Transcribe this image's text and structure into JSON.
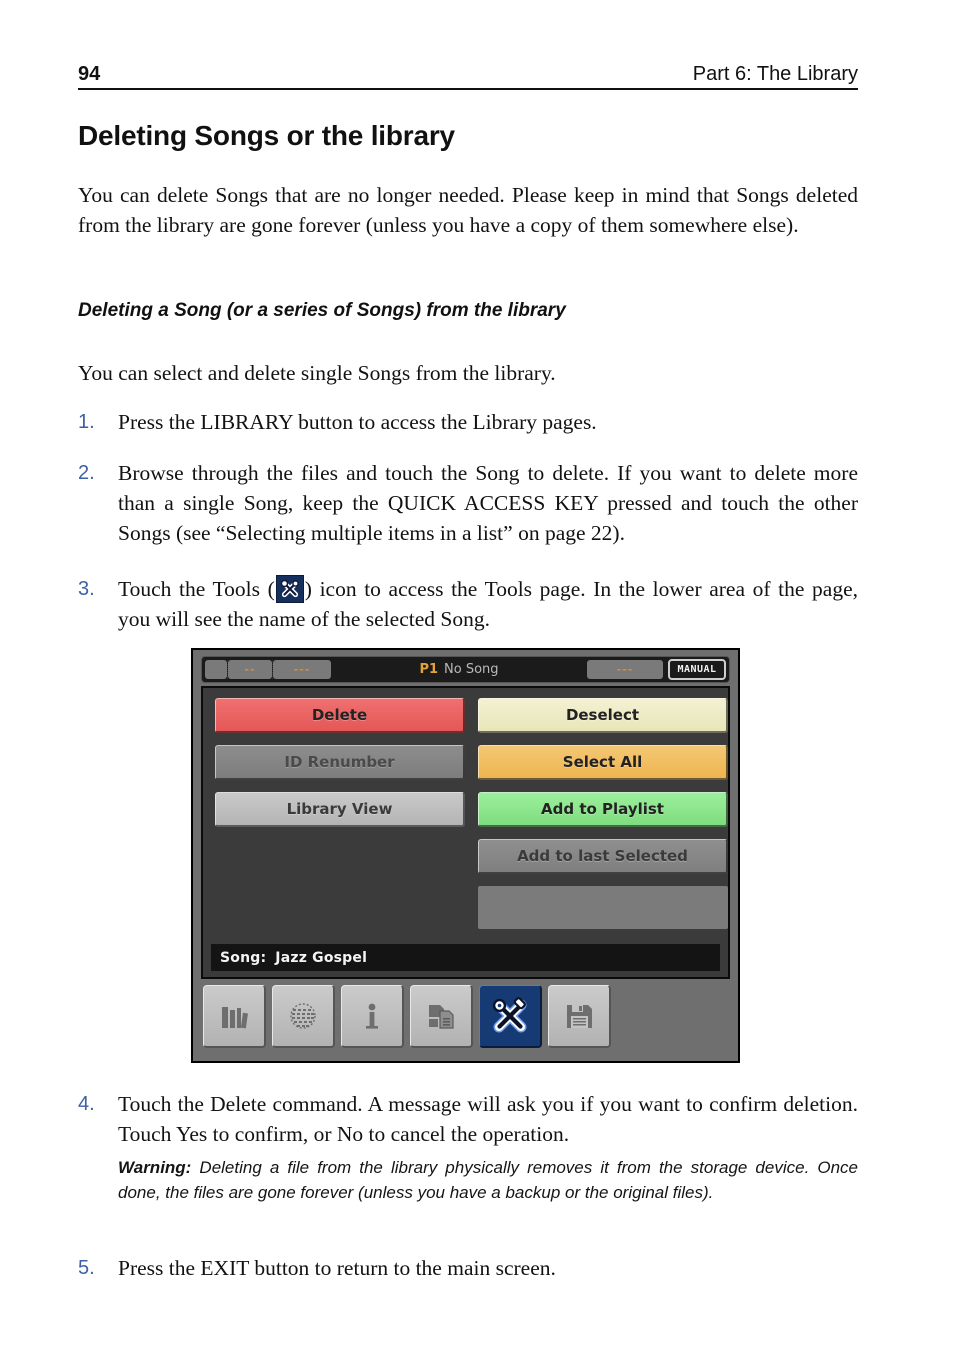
{
  "running_head": {
    "page_number": "94",
    "section": "Part 6: The Library"
  },
  "headings": {
    "h1": "Deleting Songs or the library",
    "h2": "Deleting a Song (or a series of Songs) from the library"
  },
  "paragraphs": {
    "intro": "You can delete Songs that are no longer needed. Please keep in mind that Songs deleted from the library are gone forever (unless you have a copy of them somewhere else).",
    "lead": "You can select and delete single Songs from the library."
  },
  "steps": [
    {
      "number": "1.",
      "text": "Press the LIBRARY button to access the Library pages."
    },
    {
      "number": "2.",
      "text": "Browse through the files and touch the Song to delete. If you want to delete more than a single Song, keep the QUICK ACCESS KEY pressed and touch the other Songs (see “Selecting multiple items in a list” on page 22)."
    },
    {
      "number": "3.",
      "text_before": "Touch the Tools (",
      "text_after": ") icon to access the Tools page. In the lower area of the page, you will see the name of the selected Song."
    },
    {
      "number": "4.",
      "text": "Touch the Delete command. A message will ask you if you want to confirm deletion. Touch Yes to confirm, or No to cancel the operation."
    },
    {
      "number": "5.",
      "text": "Press the EXIT button to return to the main screen."
    }
  ],
  "warning": {
    "label": "Warning:",
    "text": " Deleting a file from the library physically removes it from the storage device. Once done, the files are gone forever (unless you have a backup or the original files)."
  },
  "device": {
    "titlebar": {
      "seg1": "",
      "seg2": "--",
      "seg3": "---",
      "performance": "P1",
      "song_state": "No Song",
      "seg4": "---",
      "mode_button": "MANUAL"
    },
    "buttons_left": [
      {
        "label": "Delete",
        "style": "red"
      },
      {
        "label": "ID Renumber",
        "style": "graydark"
      },
      {
        "label": "Library View",
        "style": "graylight"
      }
    ],
    "buttons_right": [
      {
        "label": "Deselect",
        "style": "cream"
      },
      {
        "label": "Select All",
        "style": "orange"
      },
      {
        "label": "Add to Playlist",
        "style": "green"
      },
      {
        "label": "Add to last Selected",
        "style": "graymid"
      }
    ],
    "song_bar": {
      "label": "Song:",
      "value": "Jazz Gospel"
    },
    "icon_bar": [
      {
        "name": "library-books-icon",
        "active": false
      },
      {
        "name": "globe-search-icon",
        "active": false
      },
      {
        "name": "info-icon",
        "active": false
      },
      {
        "name": "copy-file-icon",
        "active": false
      },
      {
        "name": "tools-icon",
        "active": true
      },
      {
        "name": "save-floppy-icon",
        "active": false
      }
    ]
  },
  "colors": {
    "step_number": "#3c61a5",
    "delete_red": "#ec5f5f",
    "deselect_cream": "#eeedc4",
    "select_all_orange": "#f0bd62",
    "add_playlist_green": "#8ce68c",
    "tools_active_blue": "#163a74",
    "panel_dark": "#3b3b3b",
    "device_gray": "#6f6f6f",
    "title_gold": "#e3a33c"
  }
}
